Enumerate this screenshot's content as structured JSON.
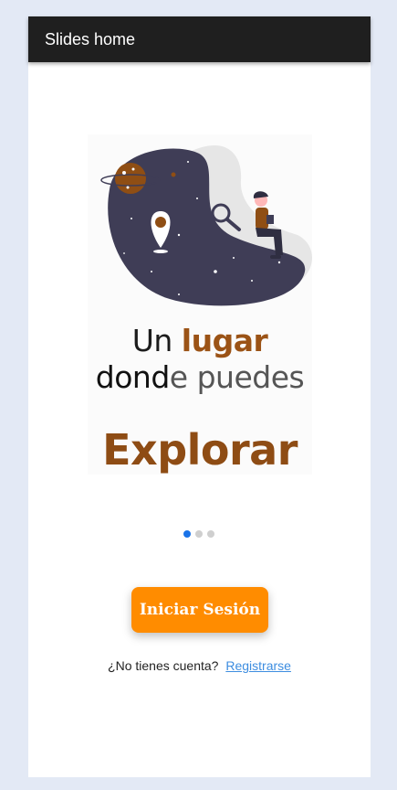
{
  "appbar": {
    "title": "Slides home"
  },
  "slide": {
    "line1_a": "Un ",
    "line1_b": "lugar",
    "line2_a": "dond",
    "line2_b": "e puedes",
    "line3": "Explorar"
  },
  "pager": {
    "count": 3,
    "active": 1
  },
  "actions": {
    "login_label": "Iniciar Sesión",
    "register_prompt": "¿No tienes cuenta?",
    "register_link": "Registrarse"
  },
  "colors": {
    "appbar": "#1f1f1f",
    "accent_orange": "#ff8c00",
    "brown": "#9b5316",
    "link": "#3d8de0",
    "dot_active": "#1a73e8"
  }
}
